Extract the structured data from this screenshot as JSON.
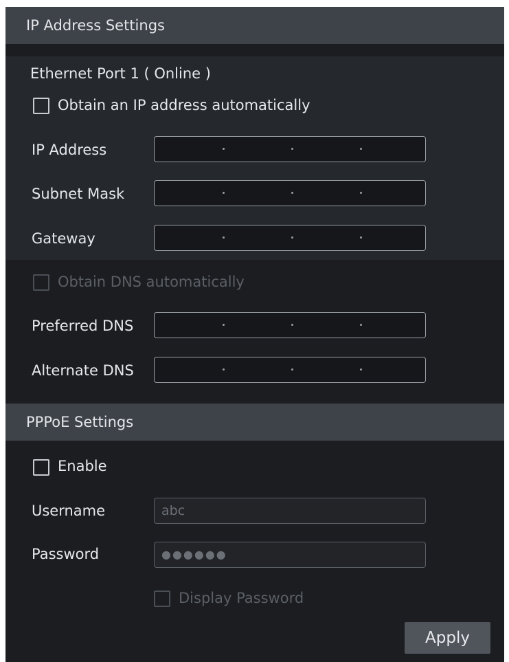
{
  "ip_section": {
    "title": "IP Address Settings",
    "port_title": "Ethernet Port 1 ( Online )",
    "auto_ip_label": "Obtain an IP address automatically",
    "fields": {
      "ip_address": "IP Address",
      "subnet_mask": "Subnet Mask",
      "gateway": "Gateway"
    },
    "auto_dns_label": "Obtain DNS automatically",
    "dns": {
      "preferred": "Preferred DNS",
      "alternate": "Alternate DNS"
    }
  },
  "pppoe_section": {
    "title": "PPPoE Settings",
    "enable_label": "Enable",
    "username_label": "Username",
    "username_value": "abc",
    "password_label": "Password",
    "password_value": "●●●●●●",
    "display_password_label": "Display Password"
  },
  "actions": {
    "apply_label": "Apply"
  },
  "checkbox_states": {
    "auto_ip": false,
    "auto_dns": false,
    "enable_pppoe": false,
    "display_password": false
  },
  "colors": {
    "panel_bg": "#1b1d21",
    "header_bg": "#3e4249",
    "section_bg": "#25282d",
    "text": "#e6e8eb",
    "disabled_text": "#5b5f66"
  }
}
